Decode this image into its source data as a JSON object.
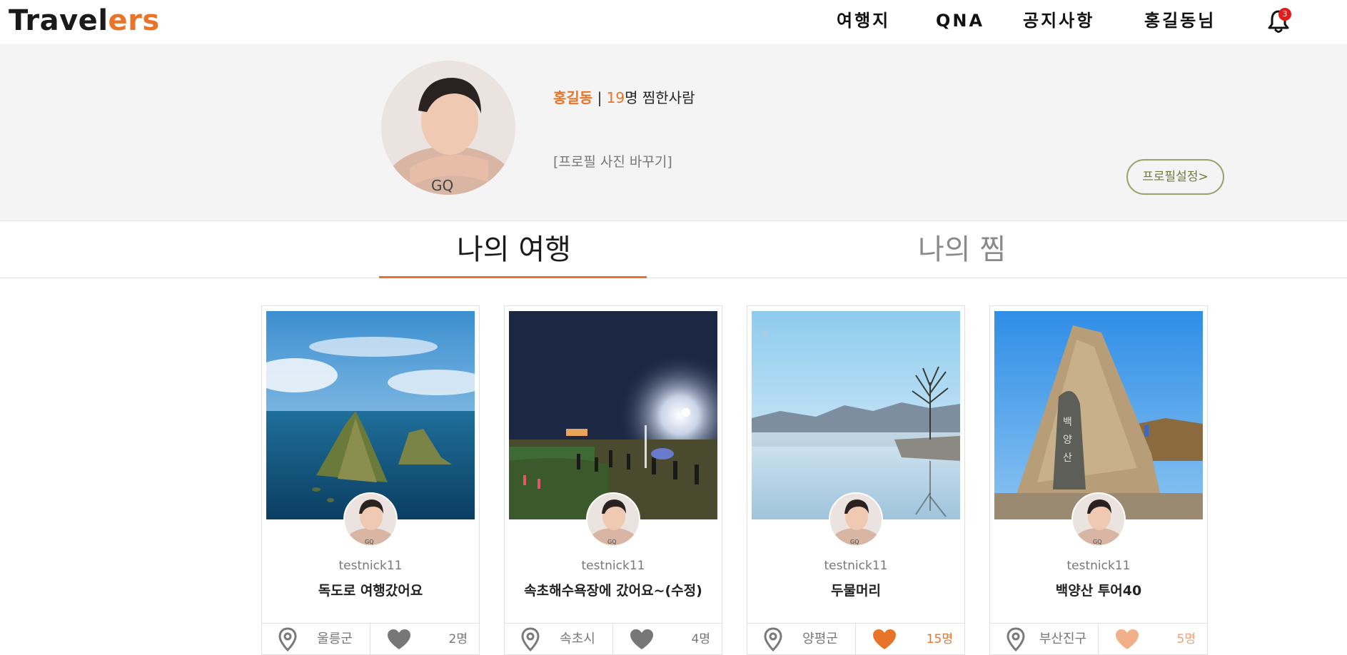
{
  "header": {
    "logo_part1": "Travel",
    "logo_part2": "ers",
    "nav": [
      "여행지",
      "QNA",
      "공지사항",
      "홍길동님"
    ],
    "notification_count": "3"
  },
  "profile": {
    "name": "홍길동",
    "separator": "|",
    "count": "19",
    "count_suffix": "명 찜한사람",
    "change_photo": "[프로필 사진 바꾸기]",
    "settings_label": "프로필설정>"
  },
  "tabs": {
    "active": "나의 여행",
    "idle": "나의 찜"
  },
  "cards": [
    {
      "user": "testnick11",
      "title": "독도로 여행갔어요",
      "region": "울릉군",
      "likes": "2명",
      "heart_color": "#777777",
      "likes_color": "#777777"
    },
    {
      "user": "testnick11",
      "title": "속초해수욕장에 갔어요~(수정)",
      "region": "속초시",
      "likes": "4명",
      "heart_color": "#777777",
      "likes_color": "#777777"
    },
    {
      "user": "testnick11",
      "title": "두물머리",
      "region": "양평군",
      "likes": "15명",
      "heart_color": "#e8742a",
      "likes_color": "#e8742a"
    },
    {
      "user": "testnick11",
      "title": "백양산 투어40",
      "region": "부산진구",
      "likes": "5명",
      "heart_color": "#f2b08a",
      "likes_color": "#f2a070"
    }
  ],
  "colors": {
    "accent": "#e8742a",
    "settings_border": "#9aa06a",
    "badge": "#e31b1b"
  }
}
